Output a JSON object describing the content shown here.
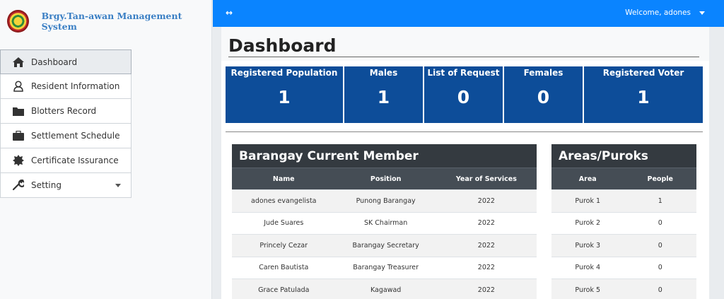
{
  "sidebar": {
    "brand": "Brgy.Tan-awan Management System",
    "items": [
      {
        "label": "Dashboard"
      },
      {
        "label": "Resident Information"
      },
      {
        "label": "Blotters Record"
      },
      {
        "label": "Settlement Schedule"
      },
      {
        "label": "Certificate Issurance"
      },
      {
        "label": "Setting"
      }
    ]
  },
  "topbar": {
    "toggle": "↔",
    "welcome": "Welcome, adones"
  },
  "page": {
    "title": "Dashboard"
  },
  "stats": [
    {
      "label": "Registered Population",
      "value": "1"
    },
    {
      "label": "Males",
      "value": "1"
    },
    {
      "label": "List of Request",
      "value": "0"
    },
    {
      "label": "Females",
      "value": "0"
    },
    {
      "label": "Registered Voter",
      "value": "1"
    }
  ],
  "members": {
    "title": "Barangay Current Member",
    "columns": [
      "Name",
      "Position",
      "Year of Services"
    ],
    "rows": [
      [
        "adones evangelista",
        "Punong Barangay",
        "2022"
      ],
      [
        "Jude Suares",
        "SK Chairman",
        "2022"
      ],
      [
        "Princely Cezar",
        "Barangay Secretary",
        "2022"
      ],
      [
        "Caren Bautista",
        "Barangay Treasurer",
        "2022"
      ],
      [
        "Grace Patulada",
        "Kagawad",
        "2022"
      ]
    ]
  },
  "areas": {
    "title": "Areas/Puroks",
    "columns": [
      "Area",
      "People"
    ],
    "rows": [
      [
        "Purok 1",
        "1"
      ],
      [
        "Purok 2",
        "0"
      ],
      [
        "Purok 3",
        "0"
      ],
      [
        "Purok 4",
        "0"
      ],
      [
        "Purok 5",
        "0"
      ]
    ]
  },
  "colors": {
    "topbar": "#0a84ff",
    "stat_tile": "#0d4d99",
    "card_header": "#343a40",
    "table_header": "#454d55"
  }
}
